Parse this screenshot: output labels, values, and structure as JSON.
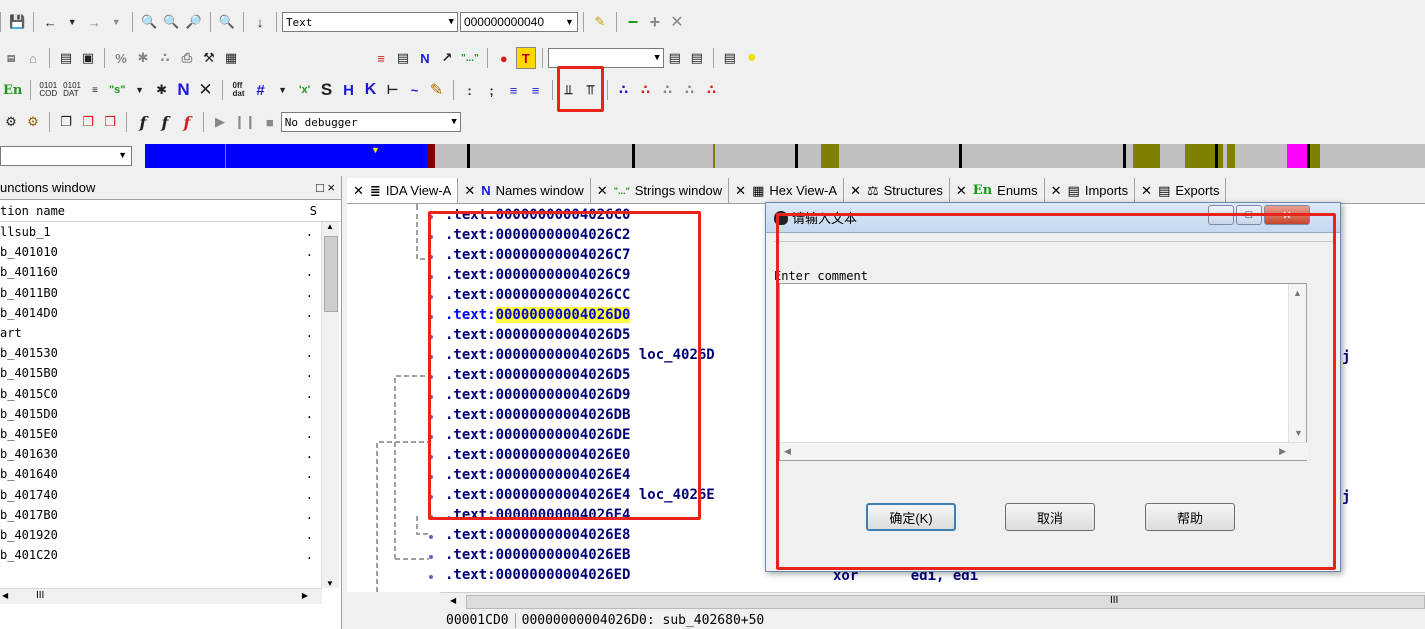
{
  "toolbar": {
    "row1": {
      "segment_combo": "Text",
      "address_combo": "000000000040"
    },
    "row3": {
      "en_label": "En",
      "cod_label": "0101\nCOD",
      "dat_label": "0101\nDAT",
      "s_label": "\"s\"",
      "n_label": "N",
      "off_label": "0ff\ndat",
      "s_button": "S",
      "k_button": "K"
    },
    "row4": {
      "debugger_combo": "No debugger"
    },
    "colors": {
      "accent_red": "#e8231c",
      "nav_blue": "#0000ff",
      "nav_olive": "#808000",
      "nav_magenta": "#ff00ff",
      "code_blue": "#000078",
      "highlight_yellow": "#ffff40"
    }
  },
  "functions_window": {
    "title": "unctions window",
    "close_glyphs": "□ ×",
    "column_name": "tion name",
    "column_s": "S",
    "rows": [
      {
        "name": "llsub_1",
        "s": "."
      },
      {
        "name": "b_401010",
        "s": "."
      },
      {
        "name": "b_401160",
        "s": "."
      },
      {
        "name": "b_4011B0",
        "s": "."
      },
      {
        "name": "b_4014D0",
        "s": "."
      },
      {
        "name": "art",
        "s": "."
      },
      {
        "name": "b_401530",
        "s": "."
      },
      {
        "name": "b_4015B0",
        "s": "."
      },
      {
        "name": "b_4015C0",
        "s": "."
      },
      {
        "name": "b_4015D0",
        "s": "."
      },
      {
        "name": "b_4015E0",
        "s": "."
      },
      {
        "name": "b_401630",
        "s": "."
      },
      {
        "name": "b_401640",
        "s": "."
      },
      {
        "name": "b_401740",
        "s": "."
      },
      {
        "name": "b_4017B0",
        "s": "."
      },
      {
        "name": "b_401920",
        "s": "."
      },
      {
        "name": "b_401C20",
        "s": "."
      }
    ],
    "hscroll_mark": "III"
  },
  "tabs": [
    {
      "label": "IDA View-A",
      "icon": "text-doc-icon"
    },
    {
      "label": "Names window",
      "icon": "N"
    },
    {
      "label": "Strings window",
      "icon": "\"...\""
    },
    {
      "label": "Hex View-A",
      "icon": "hex-icon"
    },
    {
      "label": "Structures",
      "icon": "struct-icon"
    },
    {
      "label": "Enums",
      "icon": "En"
    },
    {
      "label": "Imports",
      "icon": "imports-icon"
    },
    {
      "label": "Exports",
      "icon": "exports-icon"
    }
  ],
  "disasm": {
    "lines": [
      {
        "prefix": ".text:",
        "addr": "00000000004026C0",
        "suffix": ""
      },
      {
        "prefix": ".text:",
        "addr": "00000000004026C2",
        "suffix": ""
      },
      {
        "prefix": ".text:",
        "addr": "00000000004026C7",
        "suffix": ""
      },
      {
        "prefix": ".text:",
        "addr": "00000000004026C9",
        "suffix": ""
      },
      {
        "prefix": ".text:",
        "addr": "00000000004026CC",
        "suffix": ""
      },
      {
        "prefix": ".text:",
        "addr": "00000000004026D0",
        "suffix": "",
        "highlight": true
      },
      {
        "prefix": ".text:",
        "addr": "00000000004026D5",
        "suffix": ""
      },
      {
        "prefix": ".text:",
        "addr": "00000000004026D5",
        "suffix": " loc_4026D"
      },
      {
        "prefix": ".text:",
        "addr": "00000000004026D5",
        "suffix": ""
      },
      {
        "prefix": ".text:",
        "addr": "00000000004026D9",
        "suffix": ""
      },
      {
        "prefix": ".text:",
        "addr": "00000000004026DB",
        "suffix": ""
      },
      {
        "prefix": ".text:",
        "addr": "00000000004026DE",
        "suffix": ""
      },
      {
        "prefix": ".text:",
        "addr": "00000000004026E0",
        "suffix": ""
      },
      {
        "prefix": ".text:",
        "addr": "00000000004026E4",
        "suffix": ""
      },
      {
        "prefix": ".text:",
        "addr": "00000000004026E4",
        "suffix": " loc_4026E"
      },
      {
        "prefix": ".text:",
        "addr": "00000000004026E4",
        "suffix": ""
      },
      {
        "prefix": ".text:",
        "addr": "00000000004026E8",
        "suffix": ""
      },
      {
        "prefix": ".text:",
        "addr": "00000000004026EB",
        "suffix": ""
      },
      {
        "prefix": ".text:",
        "addr": "00000000004026ED",
        "suffix": ""
      }
    ],
    "last_instr": {
      "mnemonic": "xor",
      "operands": "edi, edi"
    },
    "right_edge_glyph": "j",
    "hscroll_mark": "III"
  },
  "status": {
    "offset": "00001CD0",
    "location": "00000000004026D0: sub_402680+50"
  },
  "dialog": {
    "title": "请输入文本",
    "prompt": "Enter comment",
    "value": "",
    "ok_label": "确定(K)",
    "cancel_label": "取消",
    "help_label": "帮助"
  }
}
